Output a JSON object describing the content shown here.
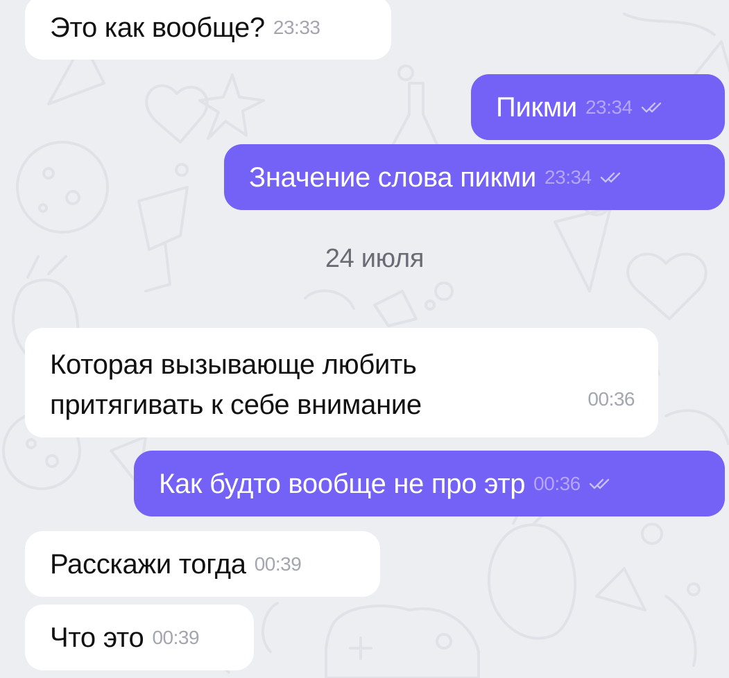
{
  "messages": [
    {
      "direction": "incoming",
      "text": "Это как вообще?",
      "time": "23:33"
    },
    {
      "direction": "outgoing",
      "text": "Пикми",
      "time": "23:34",
      "status": "read"
    },
    {
      "direction": "outgoing",
      "text": "Значение слова пикми",
      "time": "23:34",
      "status": "read"
    },
    {
      "direction": "incoming",
      "text": "Которая вызывающе любить притягивать к себе внимание",
      "time": "00:36"
    },
    {
      "direction": "outgoing",
      "text": "Как будто вообще не про этр",
      "time": "00:36",
      "status": "read"
    },
    {
      "direction": "incoming",
      "text": "Расскажи тогда",
      "time": "00:39"
    },
    {
      "direction": "incoming",
      "text": "Что это",
      "time": "00:39"
    }
  ],
  "date_separator": "24 июля",
  "icons": {
    "read_status": "double-check-icon"
  },
  "colors": {
    "background": "#EDEEF2",
    "outgoing_bubble": "#7461F5",
    "incoming_bubble": "#FFFFFF"
  }
}
